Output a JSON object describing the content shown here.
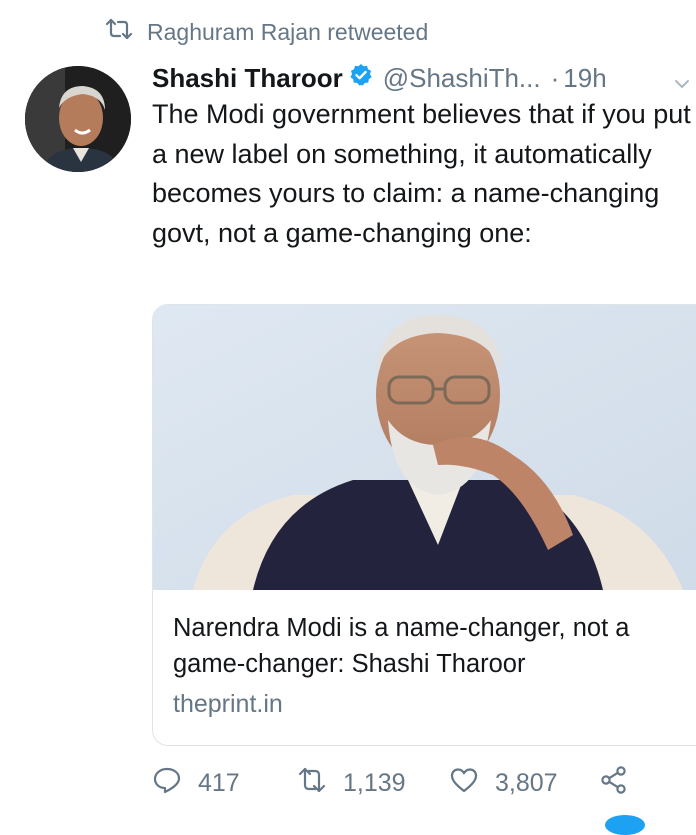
{
  "retweet_context": {
    "icon": "retweet-icon",
    "text": "Raghuram Rajan retweeted"
  },
  "tweet": {
    "author_name": "Shashi Tharoor",
    "verified": true,
    "handle": "@ShashiTh...",
    "separator": "·",
    "time": "19h",
    "text": "The Modi government believes that if you put a new label on something, it automatically becomes yours to claim: a name-changing govt, not a game-changing one:"
  },
  "card": {
    "title": "Narendra Modi is a name-changer, not a game-changer: Shashi Tharoor",
    "domain": "theprint.in"
  },
  "actions": {
    "replies": "417",
    "retweets": "1,139",
    "likes": "3,807"
  },
  "colors": {
    "secondary_text": "#657786",
    "verified_blue": "#1da1f2",
    "primary_text": "#14171a"
  }
}
